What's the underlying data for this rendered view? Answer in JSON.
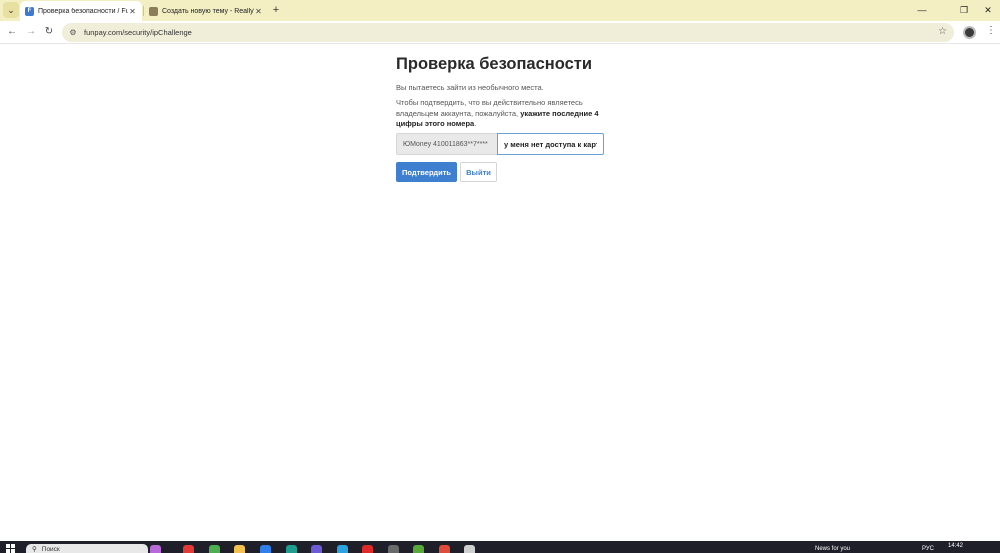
{
  "browser": {
    "tabs": [
      {
        "title": "Проверка безопасности / Fun",
        "favicon": "F",
        "active": true
      },
      {
        "title": "Создать новую тему - ReallyW",
        "favicon": "",
        "active": false
      }
    ],
    "new_tab": "+",
    "url": "funpay.com/security/ipChallenge",
    "window_controls": [
      "—",
      "❐",
      "✕"
    ]
  },
  "page": {
    "title": "Проверка безопасности",
    "intro": "Вы пытаетесь зайти из необычного места.",
    "instruction_prefix": "Чтобы подтвердить, что вы действительно являетесь владельцем аккаунта, пожалуйста, ",
    "instruction_bold": "укажите последние 4 цифры этого номера",
    "instruction_suffix": ".",
    "account_label": "ЮMoney 410011863**7****",
    "code_value": "у меня нет доступа к карт",
    "confirm_label": "Подтвердить",
    "logout_label": "Выйти"
  },
  "taskbar": {
    "search_placeholder": "Поиск",
    "news": "News for you",
    "language": "РУС",
    "time": "14:42"
  },
  "colors": {
    "primary": "#3e7fd0",
    "tabstrip": "#f3efc3",
    "omnibox": "#f0edd9",
    "taskbar": "#1f1f2a"
  }
}
